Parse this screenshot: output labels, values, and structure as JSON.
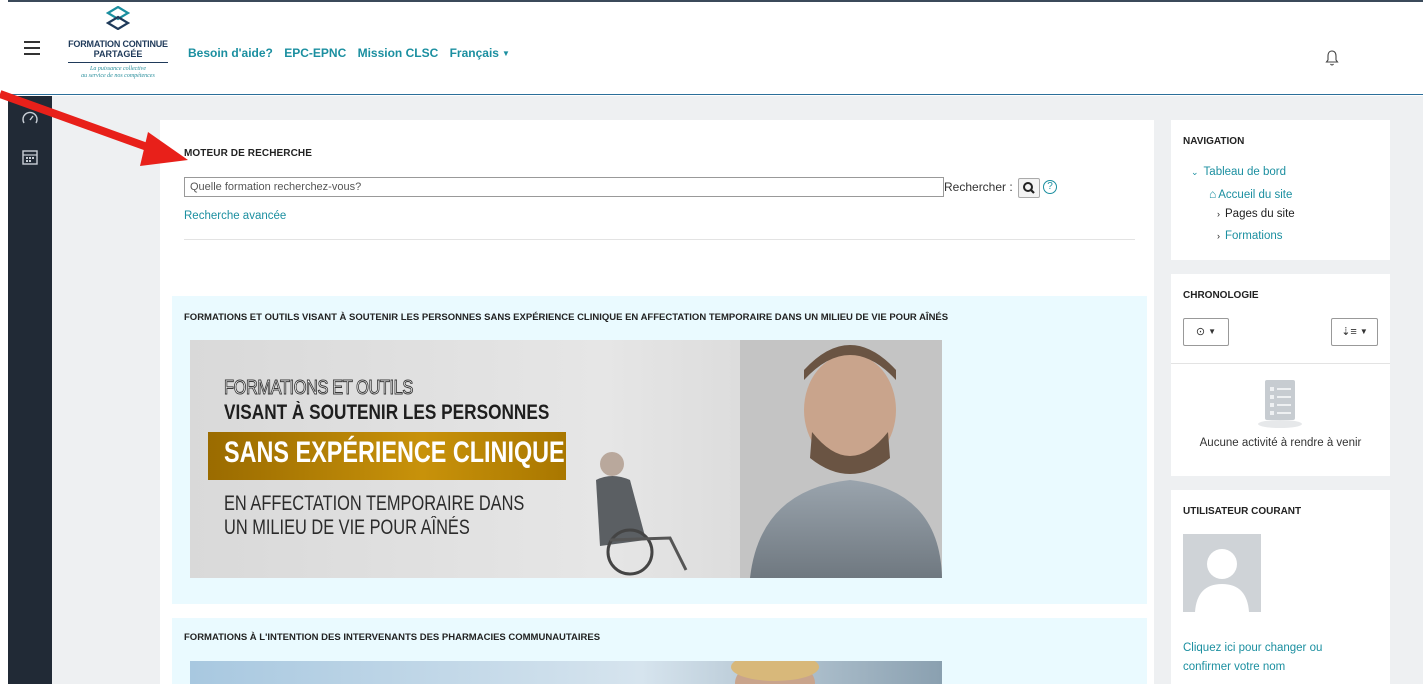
{
  "header": {
    "logo_line1": "FORMATION CONTINUE",
    "logo_line2": "PARTAGÉE",
    "logo_tagline1": "La puissance collective",
    "logo_tagline2": "au service de nos compétences",
    "nav": [
      "Besoin d'aide?",
      "EPC-EPNC",
      "Mission CLSC"
    ],
    "language": "Français"
  },
  "sidebar": {
    "icons": [
      "dashboard-icon",
      "calendar-icon"
    ]
  },
  "search": {
    "title": "MOTEUR DE RECHERCHE",
    "placeholder": "Quelle formation recherchez-vous?",
    "label": "Rechercher :",
    "advanced_link": "Recherche avancée"
  },
  "sections": [
    {
      "title": "FORMATIONS ET OUTILS VISANT À SOUTENIR LES PERSONNES SANS EXPÉRIENCE CLINIQUE EN AFFECTATION TEMPORAIRE DANS UN MILIEU DE VIE POUR AÎNÉS",
      "banner": {
        "line1": "FORMATIONS ET OUTILS",
        "line2": "VISANT À SOUTENIR LES PERSONNES",
        "line3": "SANS EXPÉRIENCE CLINIQUE",
        "line4": "EN AFFECTATION TEMPORAIRE DANS",
        "line5": "UN MILIEU DE VIE POUR AÎNÉS"
      }
    },
    {
      "title": "FORMATIONS À L'INTENTION DES INTERVENANTS DES PHARMACIES COMMUNAUTAIRES"
    }
  ],
  "navigation_block": {
    "title": "NAVIGATION",
    "items": [
      "Tableau de bord",
      "Accueil du site",
      "Pages du site",
      "Formations"
    ]
  },
  "timeline_block": {
    "title": "CHRONOLOGIE",
    "empty": "Aucune activité à rendre à venir"
  },
  "user_block": {
    "title": "UTILISATEUR COURANT",
    "link_line1": "Cliquez ici pour changer ou",
    "link_line2": "confirmer votre nom"
  },
  "colors": {
    "accent": "#1b8fa0",
    "sidebar": "#212a36",
    "section_bg": "#eafaff",
    "banner_gold": "#c8920a",
    "annotation_arrow": "#e8201a"
  }
}
